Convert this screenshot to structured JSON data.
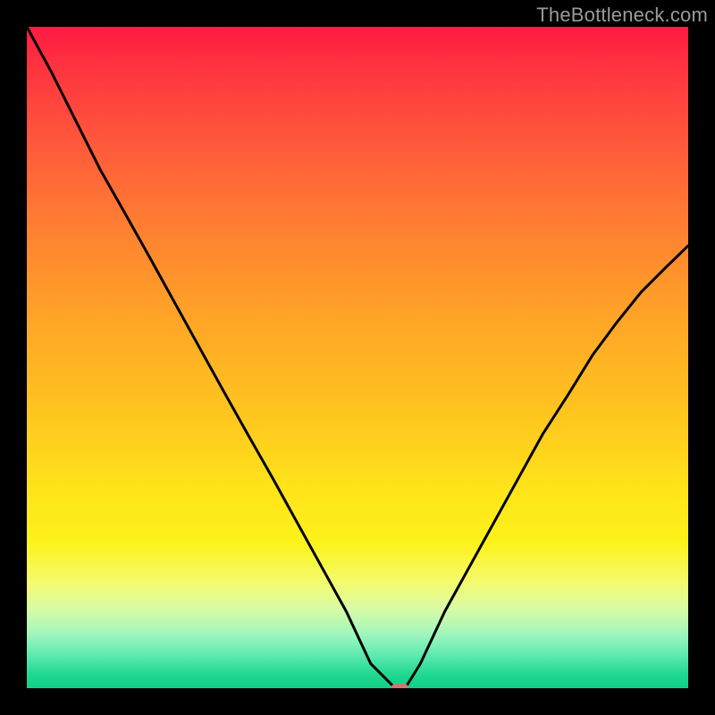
{
  "watermark": "TheBottleneck.com",
  "chart_data": {
    "type": "line",
    "title": "",
    "xlabel": "",
    "ylabel": "",
    "xlim": [
      0,
      100
    ],
    "ylim": [
      0,
      100
    ],
    "grid": false,
    "legend": false,
    "gradient_stops": [
      {
        "pos": 0,
        "color": "#ff1a41"
      },
      {
        "pos": 6,
        "color": "#ff3340"
      },
      {
        "pos": 18,
        "color": "#ff5a3b"
      },
      {
        "pos": 32,
        "color": "#ff8430"
      },
      {
        "pos": 45,
        "color": "#ffa726"
      },
      {
        "pos": 58,
        "color": "#ffc41f"
      },
      {
        "pos": 70,
        "color": "#ffe41a"
      },
      {
        "pos": 78,
        "color": "#fdf21a"
      },
      {
        "pos": 84,
        "color": "#f4fb6e"
      },
      {
        "pos": 88,
        "color": "#d9fba6"
      },
      {
        "pos": 92,
        "color": "#9df6bd"
      },
      {
        "pos": 95,
        "color": "#5de9af"
      },
      {
        "pos": 98,
        "color": "#1ed890"
      },
      {
        "pos": 100,
        "color": "#12cf85"
      }
    ],
    "series": [
      {
        "name": "curve",
        "x": [
          0.0,
          3.7,
          7.4,
          11.1,
          14.9,
          18.6,
          22.3,
          26.0,
          29.7,
          33.4,
          37.2,
          40.9,
          44.6,
          48.3,
          52.0,
          55.7,
          57.2,
          59.5,
          63.2,
          66.9,
          70.6,
          74.3,
          78.0,
          81.8,
          85.5,
          89.2,
          92.9,
          96.6,
          100.0
        ],
        "y": [
          100.0,
          93.2,
          85.8,
          78.4,
          71.7,
          65.1,
          58.4,
          51.7,
          45.0,
          38.4,
          31.7,
          25.0,
          18.3,
          11.6,
          3.7,
          0.0,
          0.0,
          3.7,
          11.6,
          18.3,
          25.0,
          31.7,
          38.4,
          44.3,
          50.3,
          55.3,
          59.9,
          63.6,
          66.9
        ]
      }
    ],
    "marker": {
      "x": 56.4,
      "y": 0.0,
      "width_pct": 2.7,
      "height_pct": 1.3,
      "color": "#dd6e74"
    }
  }
}
